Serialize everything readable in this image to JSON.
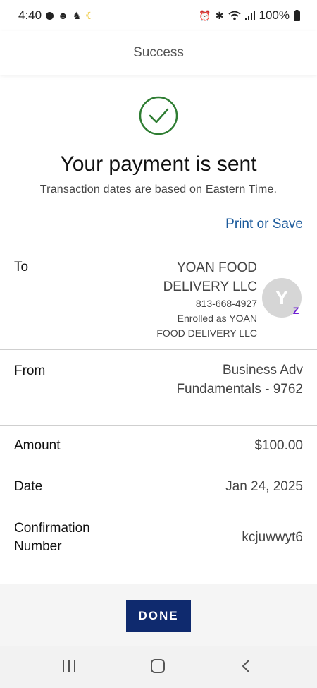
{
  "status_bar": {
    "time": "4:40",
    "battery": "100%",
    "icons": [
      "notification-dot-icon",
      "app-icon",
      "bird-icon",
      "moon-icon",
      "alarm-icon",
      "bluetooth-icon",
      "wifi-icon",
      "signal-icon",
      "battery-icon"
    ]
  },
  "header": {
    "title": "Success"
  },
  "hero": {
    "title": "Your payment is sent",
    "subtitle": "Transaction dates are based on Eastern Time.",
    "print_link": "Print or Save",
    "accent": "#2e7d32",
    "link_color": "#1b5a9b"
  },
  "details": {
    "to": {
      "label": "To",
      "name_line1": "YOAN FOOD",
      "name_line2": "DELIVERY LLC",
      "phone": "813-668-4927",
      "enrolled_line1": "Enrolled as YOAN",
      "enrolled_line2": "FOOD DELIVERY LLC",
      "avatar_initial": "Y",
      "badge": "Z"
    },
    "from": {
      "label": "From",
      "value_line1": "Business Adv",
      "value_line2": "Fundamentals - 9762"
    },
    "amount": {
      "label": "Amount",
      "value": "$100.00"
    },
    "date": {
      "label": "Date",
      "value": "Jan 24, 2025"
    },
    "confirmation": {
      "label_line1": "Confirmation",
      "label_line2": "Number",
      "value": "kcjuwwyt6"
    }
  },
  "footer": {
    "done_label": "DONE",
    "button_color": "#0f2a6e"
  },
  "nav": {
    "recents_icon": "recents-icon",
    "home_icon": "home-icon",
    "back_icon": "back-icon"
  }
}
